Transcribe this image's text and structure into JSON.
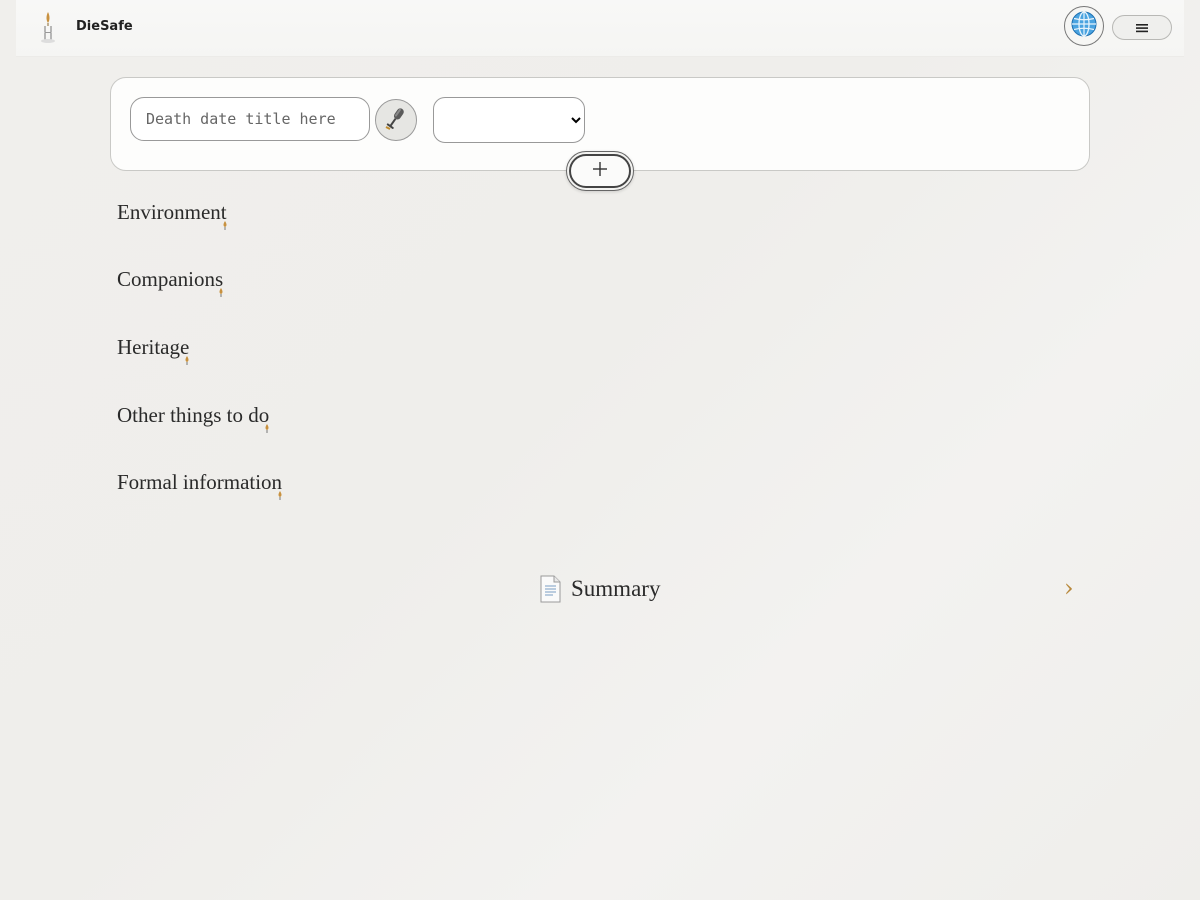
{
  "header": {
    "brand": "DieSafe",
    "logo_icon": "candle-icon",
    "language_icon": "globe-icon",
    "menu_icon": "hamburger-menu-icon"
  },
  "form": {
    "title_placeholder": "Death date title here",
    "title_value": "",
    "mic_icon": "microphone-icon",
    "select_value": "",
    "add_label": "+"
  },
  "sections": [
    {
      "label": "Environment"
    },
    {
      "label": "Companions"
    },
    {
      "label": "Heritage"
    },
    {
      "label": "Other things to do"
    },
    {
      "label": "Formal information"
    }
  ],
  "summary": {
    "icon": "document-icon",
    "label": "Summary",
    "chevron": "›"
  },
  "colors": {
    "accent": "#b8883a",
    "background": "#efeeeb"
  }
}
